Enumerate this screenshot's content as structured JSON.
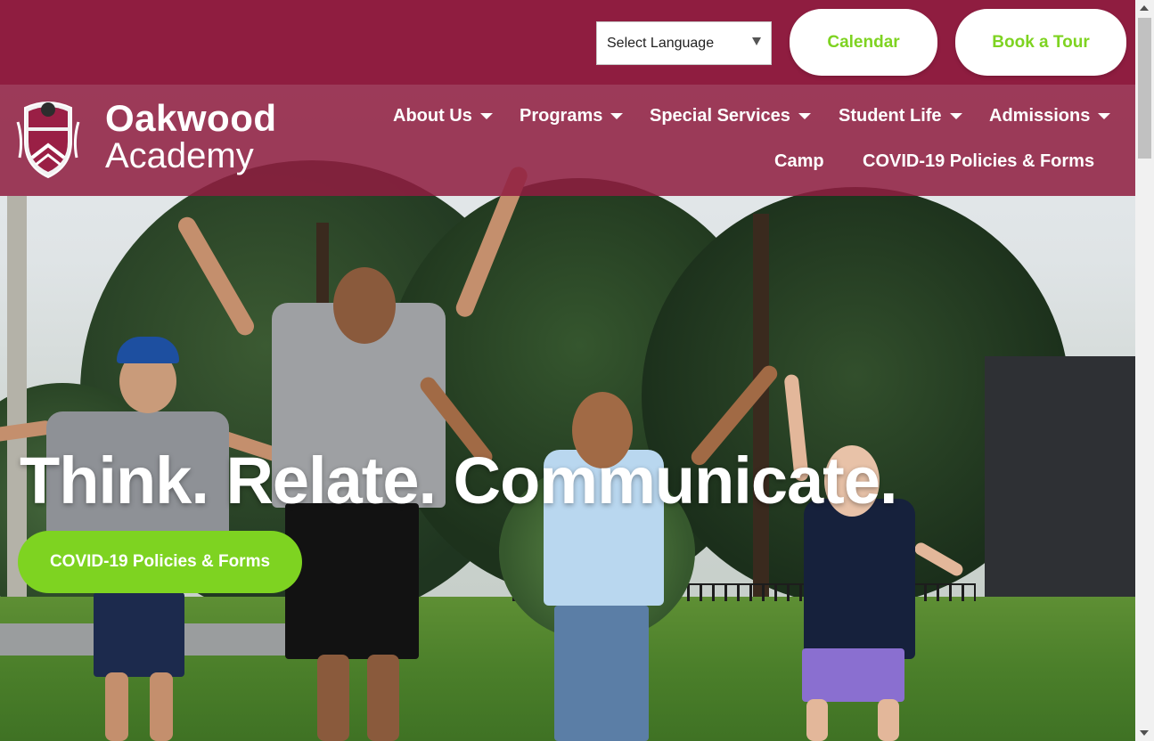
{
  "header": {
    "language_select": {
      "value": "Select Language"
    },
    "calendar_label": "Calendar",
    "tour_label": "Book a Tour"
  },
  "brand": {
    "line1": "Oakwood",
    "line2": "Academy",
    "crest_icon": "school-crest-icon"
  },
  "nav": {
    "items": [
      {
        "label": "About Us",
        "has_dropdown": true
      },
      {
        "label": "Programs",
        "has_dropdown": true
      },
      {
        "label": "Special Services",
        "has_dropdown": true
      },
      {
        "label": "Student Life",
        "has_dropdown": true
      },
      {
        "label": "Admissions",
        "has_dropdown": true
      },
      {
        "label": "Camp",
        "has_dropdown": false
      },
      {
        "label": "COVID-19 Policies & Forms",
        "has_dropdown": false
      }
    ]
  },
  "hero": {
    "headline": "Think. Relate. Communicate.",
    "cta_label": "COVID-19 Policies & Forms"
  },
  "colors": {
    "brand_maroon": "#8f1d40",
    "accent_green": "#7ed321",
    "white": "#ffffff"
  }
}
